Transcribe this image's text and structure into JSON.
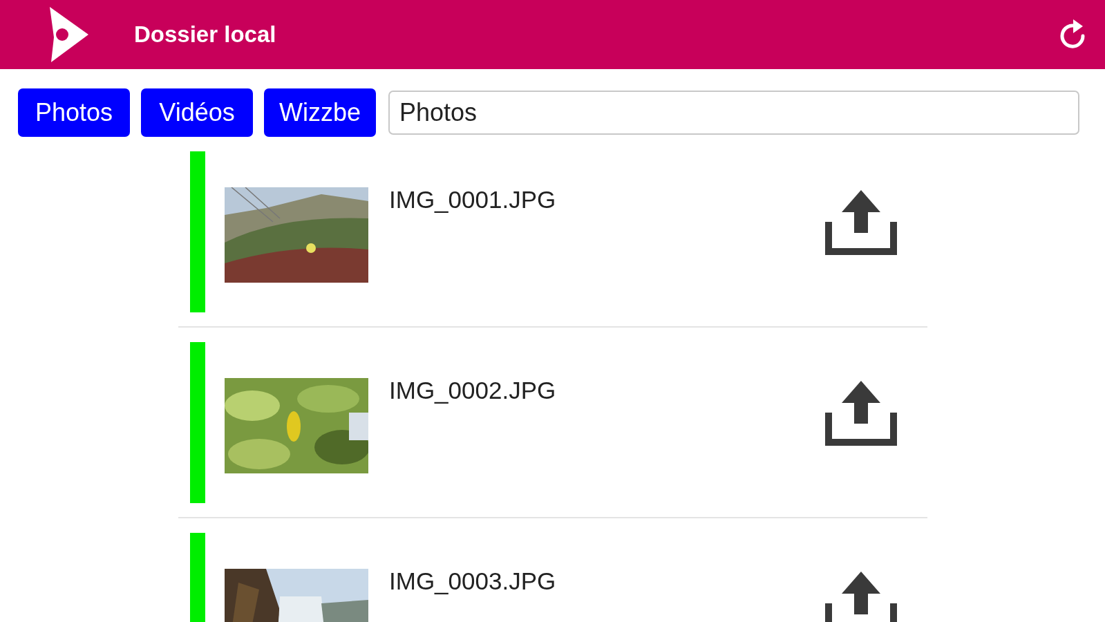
{
  "header": {
    "title": "Dossier local"
  },
  "tabs": [
    {
      "label": "Photos"
    },
    {
      "label": "Vidéos"
    },
    {
      "label": "Wizzbe"
    }
  ],
  "folder_field": {
    "value": "Photos"
  },
  "files": [
    {
      "name": "IMG_0001.JPG",
      "color": "#00ee00"
    },
    {
      "name": "IMG_0002.JPG",
      "color": "#00ee00"
    },
    {
      "name": "IMG_0003.JPG",
      "color": "#00ee00"
    }
  ]
}
